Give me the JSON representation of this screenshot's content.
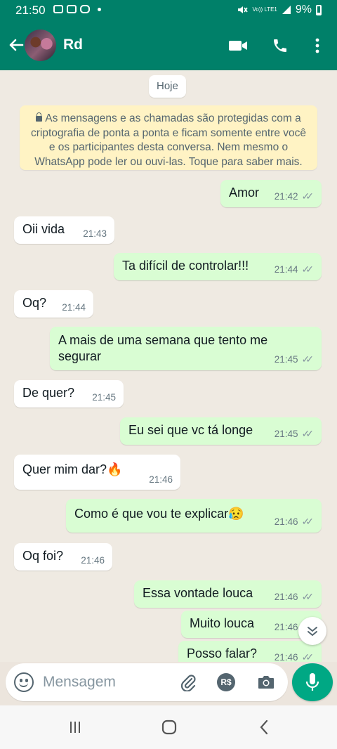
{
  "status_bar": {
    "time": "21:50",
    "network": "Vo)) LTE1",
    "battery": "9%"
  },
  "header": {
    "contact_name": "Rd"
  },
  "chat": {
    "date": "Hoje",
    "encryption_notice": "As mensagens e as chamadas são protegidas com a criptografia de ponta a ponta e ficam somente entre você e os participantes desta conversa. Nem mesmo o WhatsApp pode ler ou ouvi-las. Toque para saber mais.",
    "messages": [
      {
        "direction": "out",
        "text": "Amor",
        "time": "21:42"
      },
      {
        "direction": "in",
        "text": "Oii vida",
        "time": "21:43"
      },
      {
        "direction": "out",
        "text": "Ta difícil de controlar!!!",
        "time": "21:44"
      },
      {
        "direction": "in",
        "text": "Oq?",
        "time": "21:44"
      },
      {
        "direction": "out",
        "text": "A mais de uma semana que tento me",
        "text2": "segurar",
        "time": "21:45"
      },
      {
        "direction": "in",
        "text": "De quer?",
        "time": "21:45"
      },
      {
        "direction": "out",
        "text": "Eu sei que vc tá longe",
        "time": "21:45"
      },
      {
        "direction": "in",
        "text": "Quer mim dar?🔥",
        "time": "21:46"
      },
      {
        "direction": "out",
        "text": "Como é que vou te explicar😥",
        "time": "21:46"
      },
      {
        "direction": "in",
        "text": "Oq foi?",
        "time": "21:46"
      },
      {
        "direction": "out",
        "text": "Essa vontade louca",
        "time": "21:46"
      },
      {
        "direction": "out",
        "text": "Muito louca",
        "time": "21:46"
      },
      {
        "direction": "out",
        "text": "Posso falar?",
        "time": "21:46"
      }
    ]
  },
  "composer": {
    "placeholder": "Mensagem",
    "payment_label": "R$"
  },
  "colors": {
    "brand": "#008069",
    "outgoing_bubble": "#d9fdd3",
    "incoming_bubble": "#ffffff",
    "mic_button": "#00a884"
  }
}
